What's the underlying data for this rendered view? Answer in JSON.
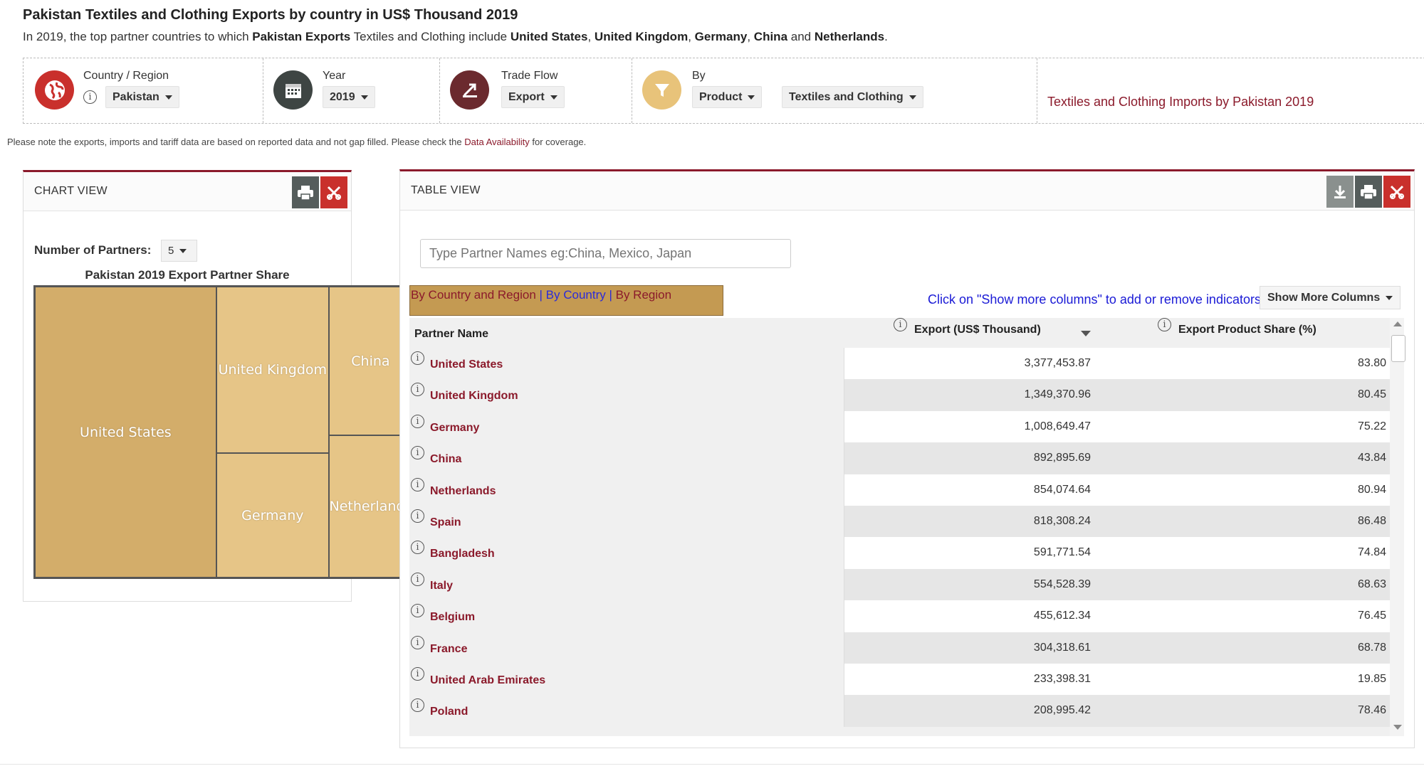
{
  "header": {
    "title": "Pakistan Textiles and Clothing Exports by country in US$ Thousand 2019",
    "subtitle_parts": [
      "In 2019, the top partner countries to which ",
      "Pakistan Exports",
      " Textiles and Clothing include ",
      "United States",
      ", ",
      "United Kingdom",
      ", ",
      "Germany",
      ", ",
      "China",
      " and ",
      "Netherlands",
      "."
    ]
  },
  "filters": {
    "country_label": "Country / Region",
    "country_value": "Pakistan",
    "year_label": "Year",
    "year_value": "2019",
    "tradeflow_label": "Trade Flow",
    "tradeflow_value": "Export",
    "by_label": "By",
    "by_value": "Product",
    "product_value": "Textiles and Clothing",
    "imports_link": "Textiles and Clothing Imports by Pakistan 2019"
  },
  "note": {
    "before": "Please note the exports, imports and tariff data are based on reported data and not gap filled. Please check the ",
    "link": "Data Availability",
    "after": " for coverage."
  },
  "chart_view": {
    "title": "CHART VIEW",
    "partners_label": "Number of Partners:",
    "partners_value": "5",
    "treemap_title": "Pakistan 2019 Export Partner Share"
  },
  "chart_data": {
    "type": "treemap",
    "title": "Pakistan 2019 Export Partner Share",
    "labels": [
      "United States",
      "United Kingdom",
      "Germany",
      "China",
      "Netherlands"
    ],
    "values": [
      3377453.87,
      1349370.96,
      1008649.47,
      892895.69,
      854074.64
    ]
  },
  "table_view": {
    "title": "TABLE VIEW",
    "search_placeholder": "Type Partner Names eg:China, Mexico, Japan",
    "group_tabs": [
      "By Country and Region",
      "By Country",
      "By Region"
    ],
    "tab_separator": " | ",
    "hint": "Click on \"Show more columns\" to add or remove indicators",
    "show_more": "Show More Columns",
    "columns": [
      "Partner Name",
      "Export (US$ Thousand)",
      "Export Product Share (%)"
    ],
    "rows": [
      {
        "name": "United States",
        "export": "3,377,453.87",
        "share": "83.80"
      },
      {
        "name": "United Kingdom",
        "export": "1,349,370.96",
        "share": "80.45"
      },
      {
        "name": "Germany",
        "export": "1,008,649.47",
        "share": "75.22"
      },
      {
        "name": "China",
        "export": "892,895.69",
        "share": "43.84"
      },
      {
        "name": "Netherlands",
        "export": "854,074.64",
        "share": "80.94"
      },
      {
        "name": "Spain",
        "export": "818,308.24",
        "share": "86.48"
      },
      {
        "name": "Bangladesh",
        "export": "591,771.54",
        "share": "74.84"
      },
      {
        "name": "Italy",
        "export": "554,528.39",
        "share": "68.63"
      },
      {
        "name": "Belgium",
        "export": "455,612.34",
        "share": "76.45"
      },
      {
        "name": "France",
        "export": "304,318.61",
        "share": "68.78"
      },
      {
        "name": "United Arab Emirates",
        "export": "233,398.31",
        "share": "19.85"
      },
      {
        "name": "Poland",
        "export": "208,995.42",
        "share": "78.46"
      }
    ]
  },
  "colors": {
    "brand": "#8b1a2b",
    "treemap_large": "#d3ad6a",
    "treemap_small": "#e6c587",
    "link_blue": "#1a1ad6"
  },
  "icons": [
    "globe-icon",
    "calendar-icon",
    "trade-flow-icon",
    "filter-icon",
    "info-icon",
    "print-icon",
    "close-icon",
    "download-icon",
    "sort-desc-icon"
  ]
}
